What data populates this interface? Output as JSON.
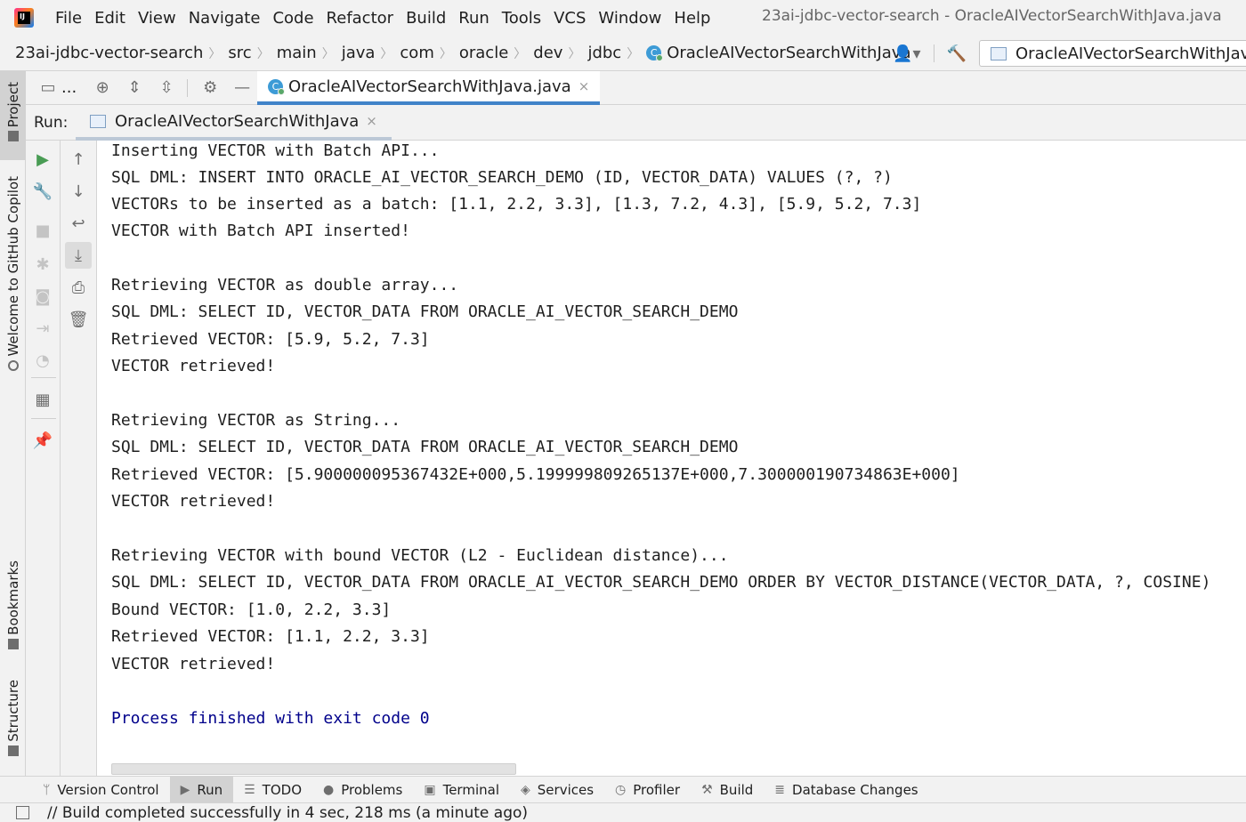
{
  "menu": {
    "items": [
      "File",
      "Edit",
      "View",
      "Navigate",
      "Code",
      "Refactor",
      "Build",
      "Run",
      "Tools",
      "VCS",
      "Window",
      "Help"
    ],
    "window_title": "23ai-jdbc-vector-search - OracleAIVectorSearchWithJava.java"
  },
  "breadcrumb": {
    "items": [
      "23ai-jdbc-vector-search",
      "src",
      "main",
      "java",
      "com",
      "oracle",
      "dev",
      "jdbc"
    ],
    "class_name": "OracleAIVectorSearchWithJava",
    "run_config": "OracleAIVectorSearchWithJava"
  },
  "left_strip": {
    "project": "Project",
    "copilot": "Welcome to GitHub Copilot",
    "bookmarks": "Bookmarks",
    "structure": "Structure"
  },
  "tab_toolbar": {
    "more": "..."
  },
  "editor_tab": {
    "label": "OracleAIVectorSearchWithJava.java",
    "close": "×"
  },
  "run_window": {
    "label": "Run:",
    "tab_label": "OracleAIVectorSearchWithJava",
    "tab_close": "×"
  },
  "console": {
    "lines": [
      "Inserting VECTOR with Batch API...",
      "SQL DML: INSERT INTO ORACLE_AI_VECTOR_SEARCH_DEMO (ID, VECTOR_DATA) VALUES (?, ?)",
      "VECTORs to be inserted as a batch: [1.1, 2.2, 3.3], [1.3, 7.2, 4.3], [5.9, 5.2, 7.3]",
      "VECTOR with Batch API inserted!",
      "",
      "Retrieving VECTOR as double array...",
      "SQL DML: SELECT ID, VECTOR_DATA FROM ORACLE_AI_VECTOR_SEARCH_DEMO",
      "Retrieved VECTOR: [5.9, 5.2, 7.3]",
      "VECTOR retrieved!",
      "",
      "Retrieving VECTOR as String...",
      "SQL DML: SELECT ID, VECTOR_DATA FROM ORACLE_AI_VECTOR_SEARCH_DEMO",
      "Retrieved VECTOR: [5.900000095367432E+000,5.199999809265137E+000,7.300000190734863E+000]",
      "VECTOR retrieved!",
      "",
      "Retrieving VECTOR with bound VECTOR (L2 - Euclidean distance)...",
      "SQL DML: SELECT ID, VECTOR_DATA FROM ORACLE_AI_VECTOR_SEARCH_DEMO ORDER BY VECTOR_DISTANCE(VECTOR_DATA, ?, COSINE)",
      "Bound VECTOR: [1.0, 2.2, 3.3]",
      "Retrieved VECTOR: [1.1, 2.2, 3.3]",
      "VECTOR retrieved!",
      ""
    ],
    "exit_line": "Process finished with exit code 0"
  },
  "bottom_bar": {
    "items": [
      "Version Control",
      "Run",
      "TODO",
      "Problems",
      "Terminal",
      "Services",
      "Profiler",
      "Build",
      "Database Changes"
    ],
    "active": "Run"
  },
  "status": {
    "text": "// Build completed successfully in 4 sec, 218 ms (a minute ago)"
  },
  "colors": {
    "accent": "#4083c9",
    "exit_text": "#00008b",
    "run_green": "#499c54"
  }
}
